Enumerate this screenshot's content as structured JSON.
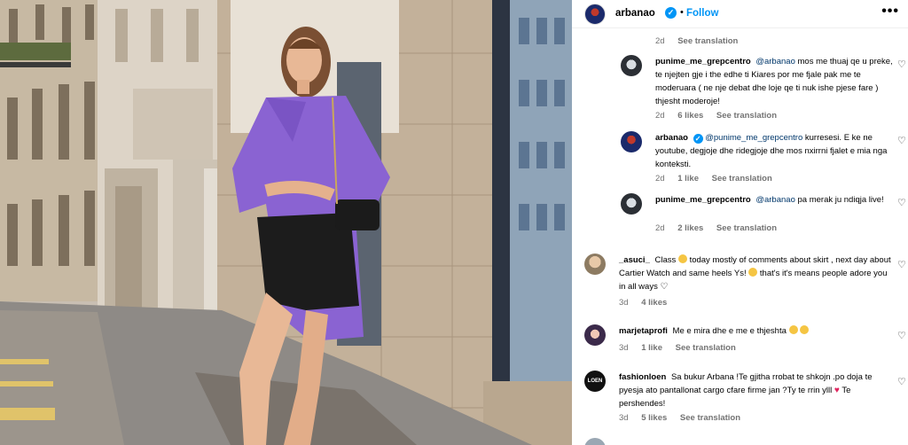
{
  "post": {
    "username": "arbanao",
    "follow_label": "Follow",
    "more_label": "•••",
    "top_meta": {
      "time": "2d",
      "see_translation": "See translation"
    }
  },
  "comments": [
    {
      "username": "punime_me_grepcentro",
      "mention": "@arbanao",
      "text": "mos me thuaj qe u preke, te njejten gje i the edhe ti Kiares por me fjale pak me te moderuara ( ne nje debat dhe loje qe ti nuk ishe pjese fare ) thjesht moderoje!",
      "time": "2d",
      "likes": "6 likes",
      "see_translation": "See translation"
    },
    {
      "username": "arbanao",
      "mention": "@punime_me_grepcentro",
      "text": "kurresesi. E ke ne youtube, degjoje dhe ridegjoje dhe mos nxirrni fjalet e mia nga konteksti.",
      "time": "2d",
      "likes": "1 like",
      "see_translation": "See translation"
    },
    {
      "username": "punime_me_grepcentro",
      "mention": "@arbanao",
      "text": "pa merak ju ndiqja live!",
      "time": "2d",
      "likes": "2 likes",
      "see_translation": "See translation"
    },
    {
      "username": "_asuci_",
      "text_a": "Class",
      "text_b": "today mostly of comments about skirt , next day about Cartier Watch and same heels Ys!",
      "text_c": "that's it's means people adore you in all ways",
      "time": "3d",
      "likes": "4 likes"
    },
    {
      "username": "marjetaprofi",
      "text": "Me e mira dhe e me e thjeshta",
      "time": "3d",
      "likes": "1 like",
      "see_translation": "See translation"
    },
    {
      "username": "fashionloen",
      "text_a": "Sa bukur Arbana !Te gjitha rrobat te shkojn .po doja te pyesja ato pantallonat cargo cfare firme jan ?Ty te rrin ylll",
      "text_b": "Te pershendes!",
      "avatar_label": "LOEN",
      "time": "3d",
      "likes": "5 likes",
      "see_translation": "See translation"
    }
  ],
  "icons": {
    "verified": "verified-badge-icon",
    "heart": "heart-outline-icon",
    "more": "more-options-icon"
  },
  "colors": {
    "accent_blue": "#0095f6",
    "mention_blue": "#00376b",
    "meta_gray": "#737373",
    "dress_purple": "#8a63d2"
  }
}
